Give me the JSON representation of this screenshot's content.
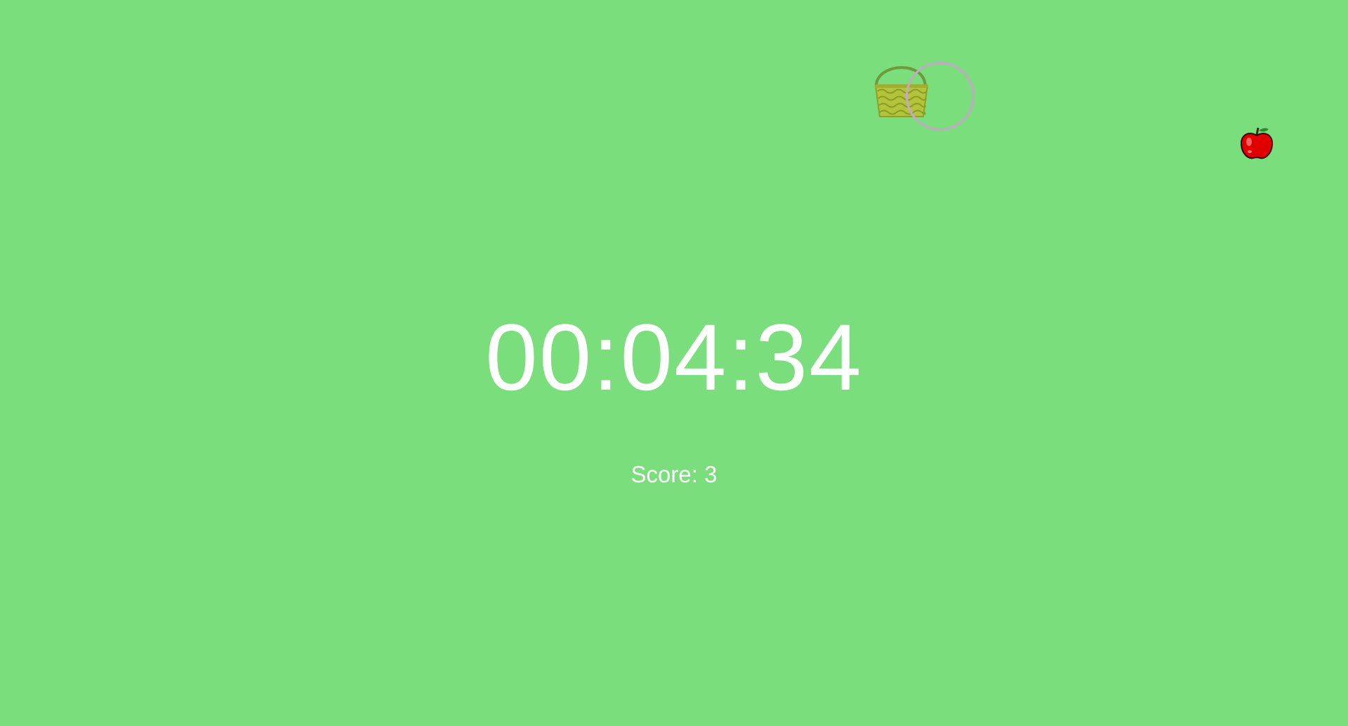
{
  "game": {
    "timer": "00:04:34",
    "score_text": "Score: 3"
  },
  "sprites": {
    "player": "basket-icon",
    "item": "apple-icon",
    "cursor": "cursor-ring"
  },
  "colors": {
    "background": "#79de7b",
    "text": "#ffffff",
    "cursor_ring": "#c7a7c8",
    "apple": "#e00000",
    "basket": "#b4c43a"
  }
}
